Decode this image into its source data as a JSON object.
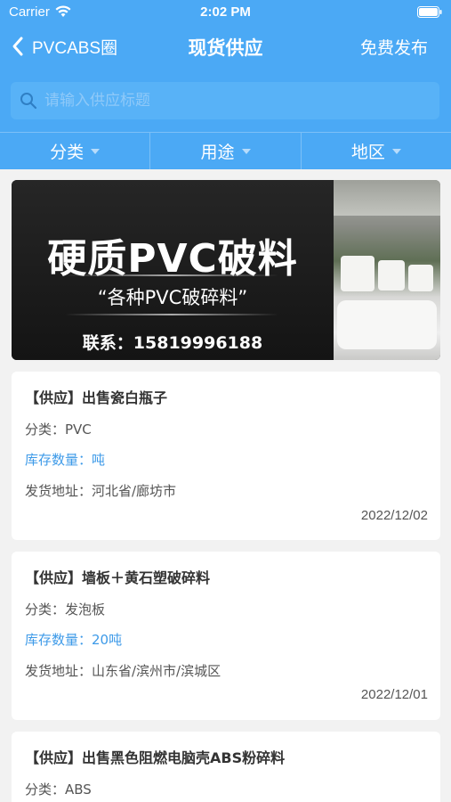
{
  "status": {
    "carrier": "Carrier",
    "time": "2:02 PM"
  },
  "nav": {
    "back_label": "PVCABS圈",
    "title": "现货供应",
    "publish_label": "免费发布"
  },
  "search": {
    "placeholder": "请输入供应标题"
  },
  "filters": [
    {
      "label": "分类"
    },
    {
      "label": "用途"
    },
    {
      "label": "地区"
    }
  ],
  "banner": {
    "title": "硬质PVC破料",
    "slogan": "“各种PVC破碎料”",
    "contact": "联系：15819996188"
  },
  "listings": [
    {
      "title": "【供应】出售瓷白瓶子",
      "category": "分类：PVC",
      "stock": "库存数量：吨",
      "address": "发货地址：河北省/廊坊市",
      "date": "2022/12/02"
    },
    {
      "title": "【供应】墙板＋黄石塑破碎料",
      "category": "分类：发泡板",
      "stock": "库存数量：20吨",
      "address": "发货地址：山东省/滨州市/滨城区",
      "date": "2022/12/01"
    },
    {
      "title": "【供应】出售黑色阻燃电脑壳ABS粉碎料",
      "category": "分类：ABS"
    }
  ],
  "colors": {
    "header": "#4ba9f5",
    "stock_text": "#3d9ae8",
    "page_bg": "#f2f2f2"
  }
}
